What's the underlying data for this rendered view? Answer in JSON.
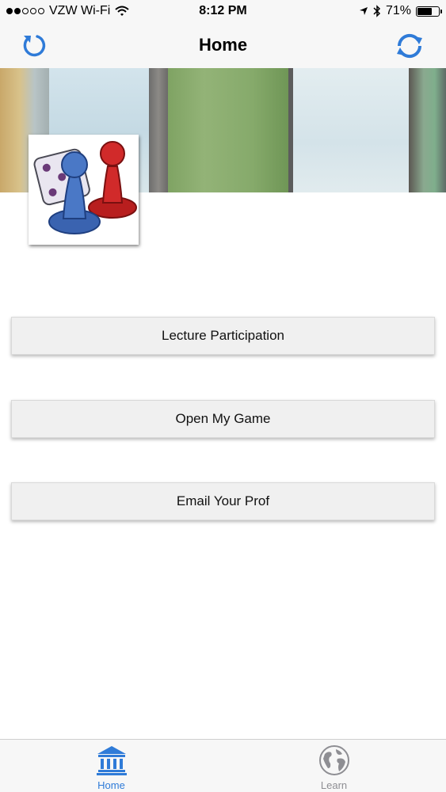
{
  "status_bar": {
    "carrier": "VZW Wi-Fi",
    "time": "8:12 PM",
    "battery_percent": "71%",
    "battery_level": 0.71
  },
  "nav": {
    "title": "Home",
    "left_icon": "refresh-icon",
    "right_icon": "sync-icon"
  },
  "buttons": {
    "lecture": "Lecture Participation",
    "game": "Open My Game",
    "email": "Email Your Prof"
  },
  "tabs": [
    {
      "label": "Home",
      "icon": "bank-icon",
      "active": true
    },
    {
      "label": "Learn",
      "icon": "globe-icon",
      "active": false
    }
  ],
  "colors": {
    "accent": "#2f7bd8",
    "inactive": "#8e8e93",
    "bar_background": "#f7f7f7"
  }
}
